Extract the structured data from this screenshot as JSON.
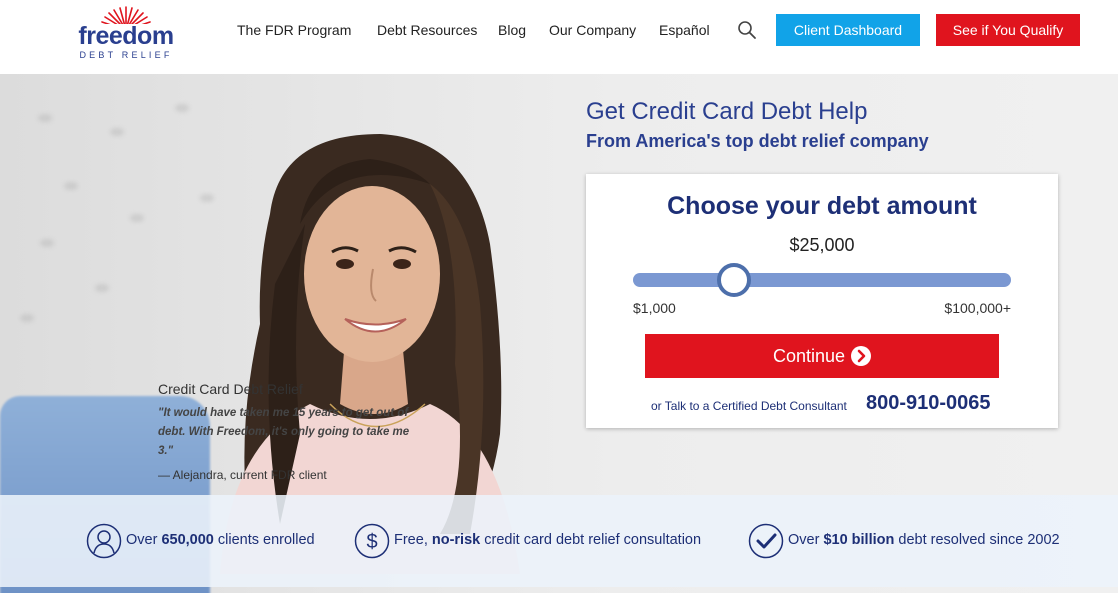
{
  "brand": {
    "name": "freedom",
    "tagline": "DEBT RELIEF"
  },
  "nav": {
    "items": [
      "The FDR Program",
      "Debt Resources",
      "Blog",
      "Our Company",
      "Español"
    ],
    "search_icon": "search-icon",
    "client_dashboard": "Client Dashboard",
    "see_if_qualify": "See if You Qualify"
  },
  "hero": {
    "headline": "Get Credit Card Debt Help",
    "subheadline": "From America's top debt relief company"
  },
  "calculator": {
    "title": "Choose your debt amount",
    "amount": "$25,000",
    "slider_min": "$1,000",
    "slider_max": "$100,000+",
    "slider_value": 25000,
    "continue_label": "Continue",
    "talk_text": "or Talk to a Certified Debt Consultant",
    "phone": "800-910-0065"
  },
  "testimonial": {
    "title": "Credit Card Debt Relief",
    "quote": "\"It would have taken me 15 years to get out of debt. With Freedom, it's only going to take me 3.\"",
    "author": "— Alejandra, current FDR client"
  },
  "stats": [
    {
      "icon": "person-icon",
      "pre": "Over ",
      "bold": "650,000",
      "post": " clients enrolled"
    },
    {
      "icon": "dollar-icon",
      "pre": "Free, ",
      "bold": "no-risk",
      "post": " credit card debt relief consultation"
    },
    {
      "icon": "checkmark-icon",
      "pre": "Over ",
      "bold": "$10 billion",
      "post": " debt resolved since 2002"
    }
  ],
  "colors": {
    "brand_blue": "#1d2f76",
    "cta_red": "#e0141e",
    "dashboard_blue": "#11a3e8",
    "slider_blue": "#7b98d2"
  }
}
